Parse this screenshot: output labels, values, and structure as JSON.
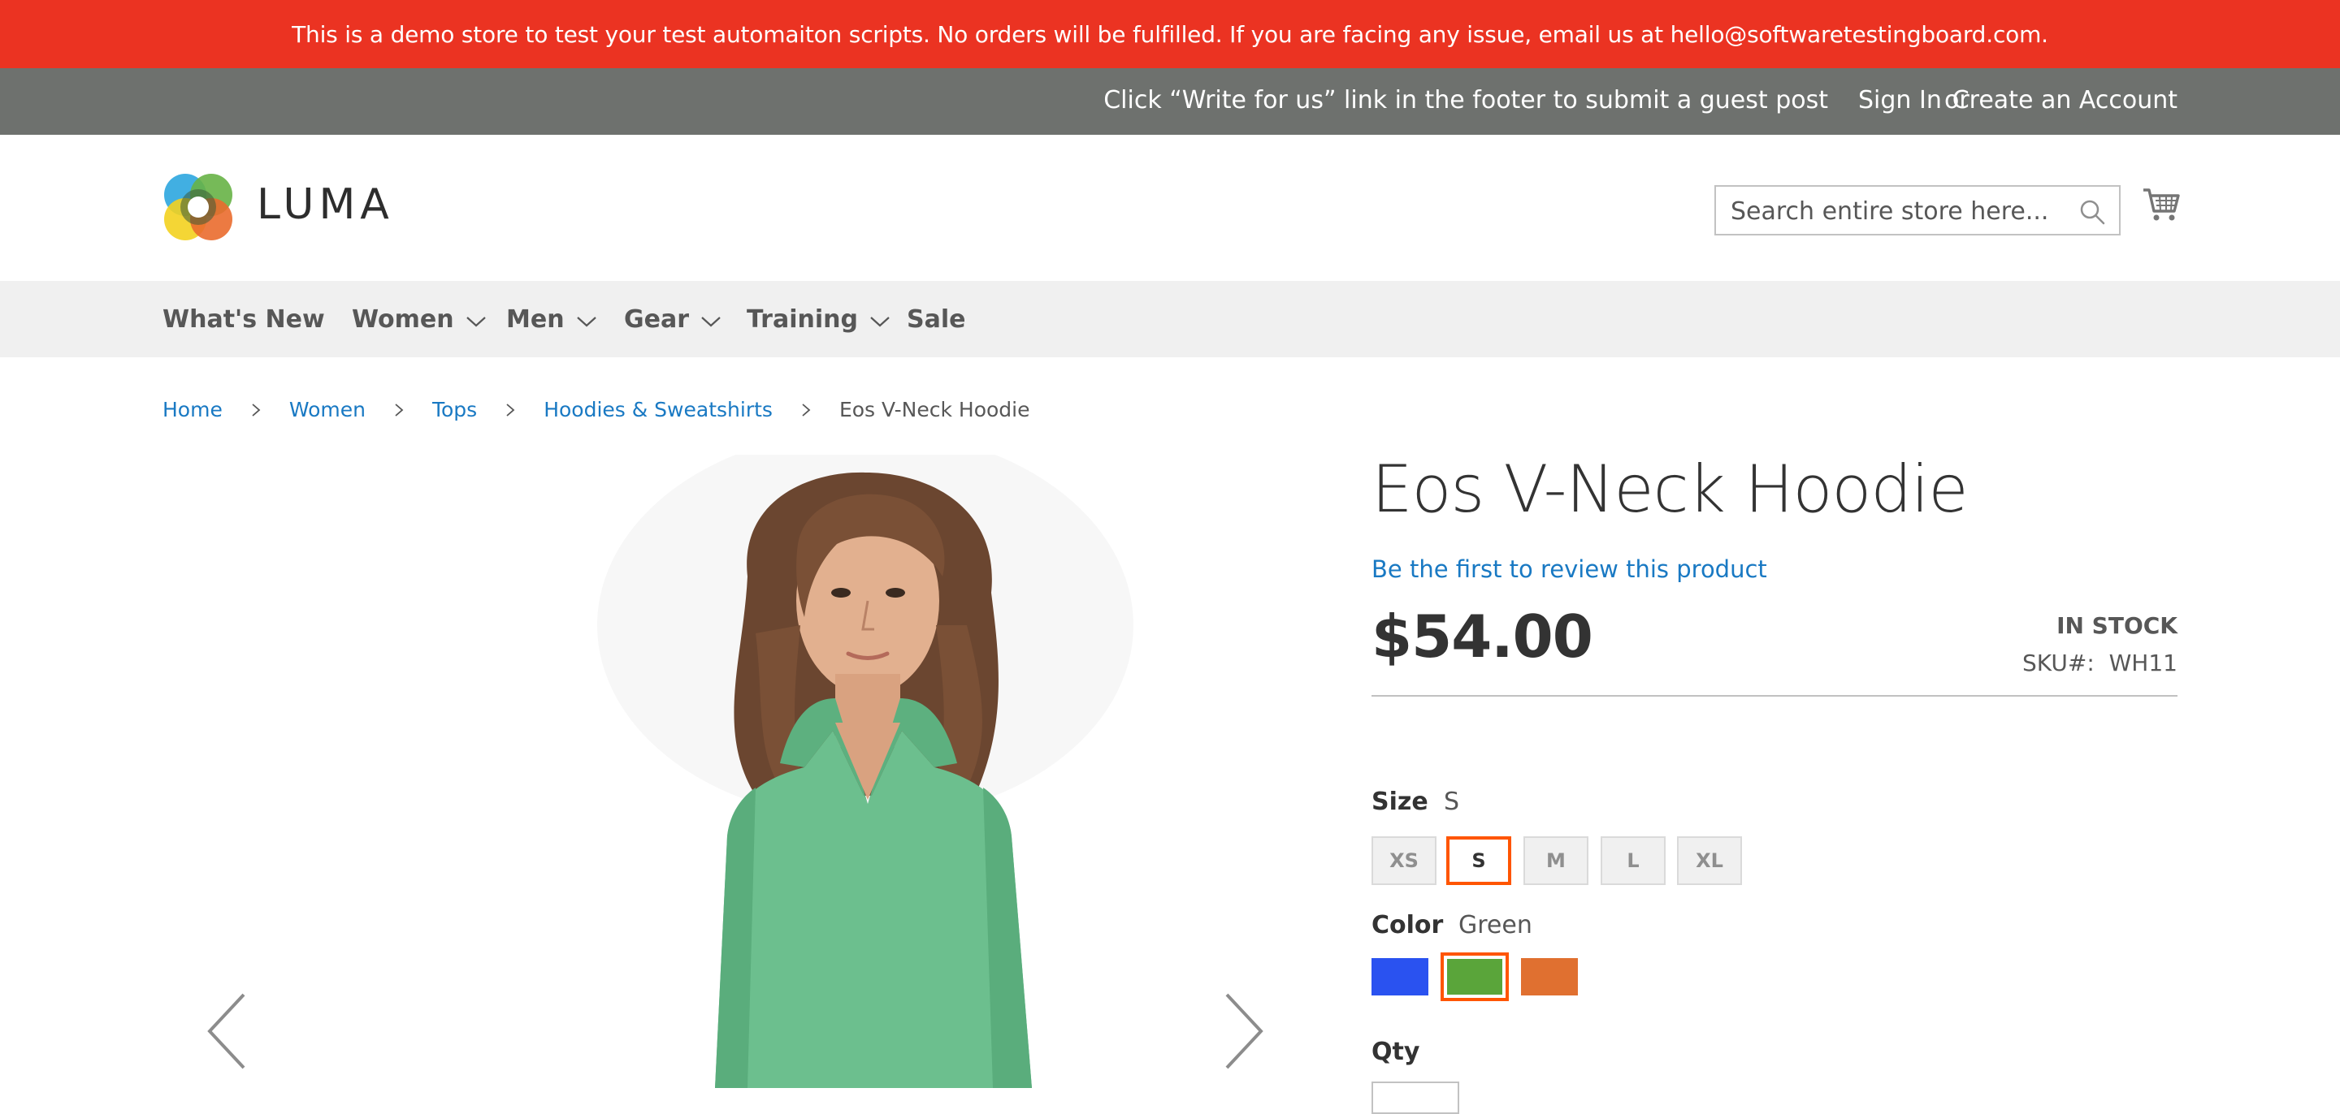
{
  "demo_banner": "This is a demo store to test your test automaiton scripts. No orders will be fulfilled. If you are facing any issue, email us at hello@softwaretestingboard.com.",
  "top_panel": {
    "message": "Click “Write for us” link in the footer to submit a guest post",
    "sign_in": "Sign In",
    "or": "or",
    "create_account": "Create an Account"
  },
  "header": {
    "logo_text": "LUMA",
    "search_placeholder": "Search entire store here..."
  },
  "nav": {
    "items": [
      {
        "label": "What's New",
        "has_dropdown": false
      },
      {
        "label": "Women",
        "has_dropdown": true
      },
      {
        "label": "Men",
        "has_dropdown": true
      },
      {
        "label": "Gear",
        "has_dropdown": true
      },
      {
        "label": "Training",
        "has_dropdown": true
      },
      {
        "label": "Sale",
        "has_dropdown": false
      }
    ]
  },
  "breadcrumbs": {
    "items": [
      "Home",
      "Women",
      "Tops",
      "Hoodies & Sweatshirts"
    ],
    "current": "Eos V-Neck Hoodie"
  },
  "product": {
    "title": "Eos V-Neck Hoodie",
    "review_link": "Be the first to review this product",
    "price": "$54.00",
    "stock": "IN STOCK",
    "sku_label": "SKU#:",
    "sku": "WH11",
    "size": {
      "label": "Size",
      "selected": "S",
      "options": [
        "XS",
        "S",
        "M",
        "L",
        "XL"
      ]
    },
    "color": {
      "label": "Color",
      "selected": "Green",
      "options": [
        {
          "name": "Blue",
          "hex": "#2a52f0"
        },
        {
          "name": "Green",
          "hex": "#5aa53a"
        },
        {
          "name": "Orange",
          "hex": "#e07030"
        }
      ]
    },
    "qty_label": "Qty"
  },
  "colors": {
    "banner_red": "#eb3322",
    "top_panel_gray": "#6e716e",
    "link_blue": "#1979c3",
    "selected_orange": "#ff5501",
    "hoodie_green": "#6cbf8e"
  }
}
